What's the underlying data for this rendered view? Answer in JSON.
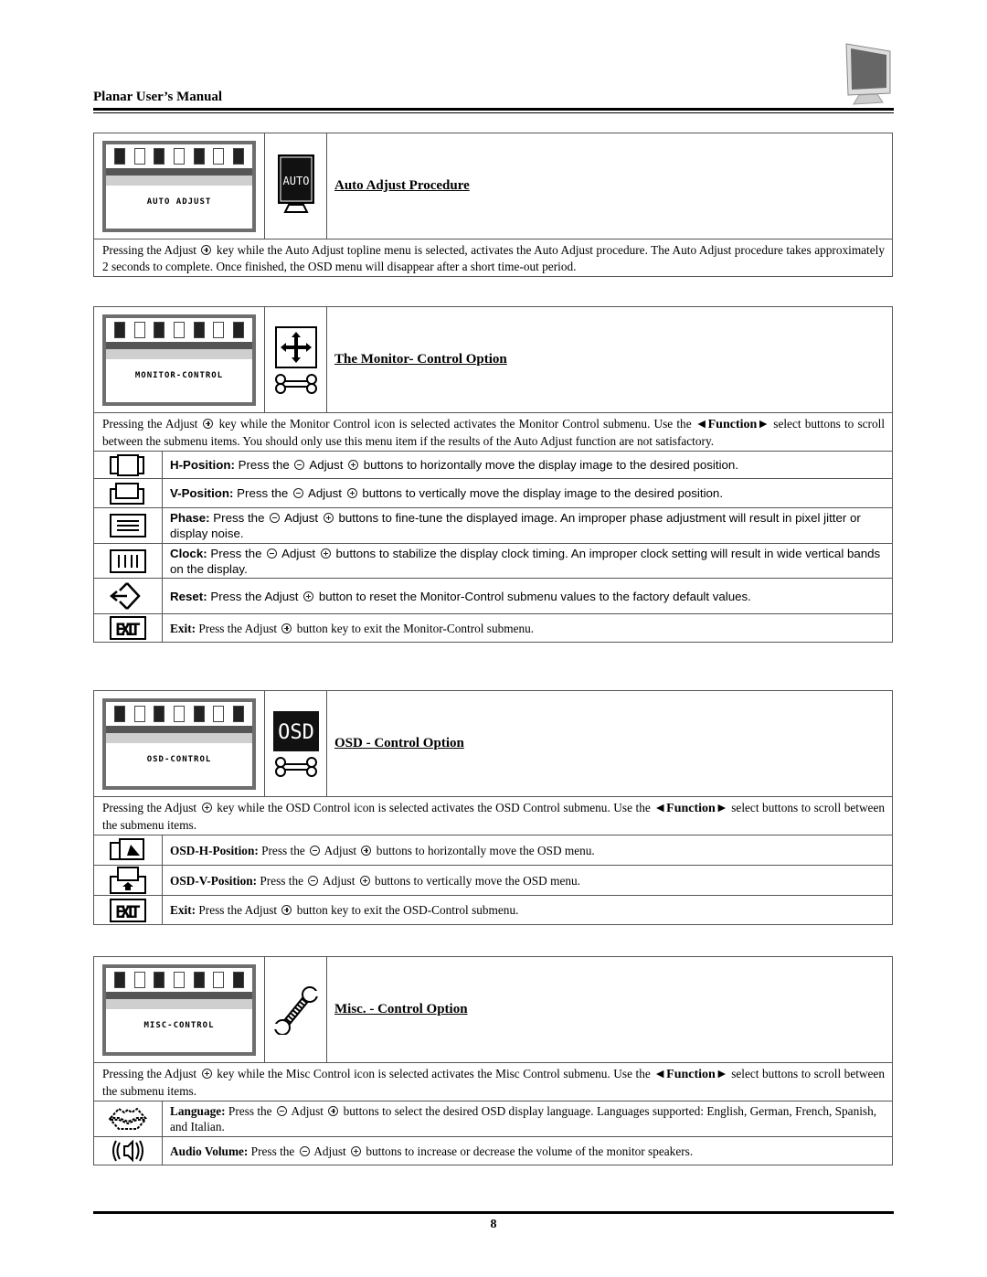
{
  "header": {
    "title": "Planar User’s Manual",
    "logo_icon": "monitor-icon"
  },
  "sections": [
    {
      "osd_label": "AUTO ADJUST",
      "icon": "auto-icon",
      "icon_text": "AUTO",
      "title": "Auto Adjust Procedure",
      "desc_parts": [
        "Pressing the Adjust ",
        " key while the Auto Adjust topline menu is selected, activates the Auto Adjust procedure.  The Auto Adjust procedure takes approximately 2 seconds to complete.  Once finished, the OSD menu will disappear after a short time-out period."
      ],
      "items": []
    },
    {
      "osd_label": "MONITOR-CONTROL",
      "icon": "move-arrows-icon",
      "title": "The Monitor- Control Option",
      "desc_parts": [
        "Pressing the Adjust ",
        " key while the Monitor Control icon is selected activates the Monitor Control submenu.  Use the ",
        "◄Function►",
        " select buttons to scroll between the submenu items.  You should only use this menu item if the results of the Auto Adjust function are not satisfactory."
      ],
      "items": [
        {
          "icon": "h-position-icon",
          "label": "H-Position:",
          "pre": " Press the ",
          "mid": " Adjust ",
          "post": " buttons to horizontally move the display image to the desired position."
        },
        {
          "icon": "v-position-icon",
          "label": "V-Position:",
          "pre": " Press the ",
          "mid": " Adjust ",
          "post": " buttons to vertically move the display image to the desired position."
        },
        {
          "icon": "phase-icon",
          "label": "Phase:",
          "pre": " Press the ",
          "mid": " Adjust ",
          "post": " buttons to fine-tune the displayed image.  An improper phase adjustment will result in pixel jitter or display noise."
        },
        {
          "icon": "clock-icon",
          "label": "Clock:",
          "pre": " Press the ",
          "mid": " Adjust ",
          "post": " buttons to stabilize the display clock timing.  An improper clock setting will result in wide vertical bands on the display."
        },
        {
          "icon": "reset-icon",
          "label": "Reset:",
          "pre": "  Press the Adjust ",
          "post": " button to reset the Monitor-Control submenu values to the factory default values."
        },
        {
          "icon": "exit-icon",
          "label": "Exit:",
          "pre": " Press the Adjust ",
          "post": " button key to exit the Monitor-Control submenu."
        }
      ]
    },
    {
      "osd_label": "OSD-CONTROL",
      "icon": "osd-icon",
      "icon_text": "OSD",
      "title": "OSD - Control Option",
      "desc_parts": [
        "Pressing the Adjust ",
        " key while the OSD Control icon is selected activates the OSD Control submenu.  Use the ",
        "◄Function►",
        " select buttons to scroll between the submenu items."
      ],
      "items": [
        {
          "icon": "osd-h-position-icon",
          "label": "OSD-H-Position:",
          "pre": " Press the ",
          "mid": " Adjust ",
          "post": " buttons to horizontally move the OSD menu."
        },
        {
          "icon": "osd-v-position-icon",
          "label": "OSD-V-Position:",
          "pre": " Press the ",
          "mid": " Adjust ",
          "post": " buttons to vertically move the OSD menu."
        },
        {
          "icon": "exit-icon",
          "label": "Exit:",
          "pre": " Press the Adjust ",
          "post": " button key to exit the OSD-Control submenu."
        }
      ]
    },
    {
      "osd_label": "MISC-CONTROL",
      "icon": "wrench-icon",
      "title": "Misc. - Control Option",
      "desc_parts": [
        "Pressing the Adjust ",
        " key while the Misc Control icon is selected activates the Misc Control submenu.  Use the ",
        "◄Function►",
        " select buttons to scroll between the submenu items."
      ],
      "items": [
        {
          "icon": "language-icon",
          "label": "Language:",
          "pre": " Press the ",
          "mid": " Adjust ",
          "post": " buttons to select the desired OSD display language.  Languages supported:  English, German, French, Spanish, and Italian."
        },
        {
          "icon": "audio-volume-icon",
          "label": "Audio Volume:",
          "pre": " Press the ",
          "mid": " Adjust ",
          "post": " buttons to increase or decrease the volume of the monitor speakers."
        }
      ]
    }
  ],
  "footer": {
    "page_number": "8"
  }
}
